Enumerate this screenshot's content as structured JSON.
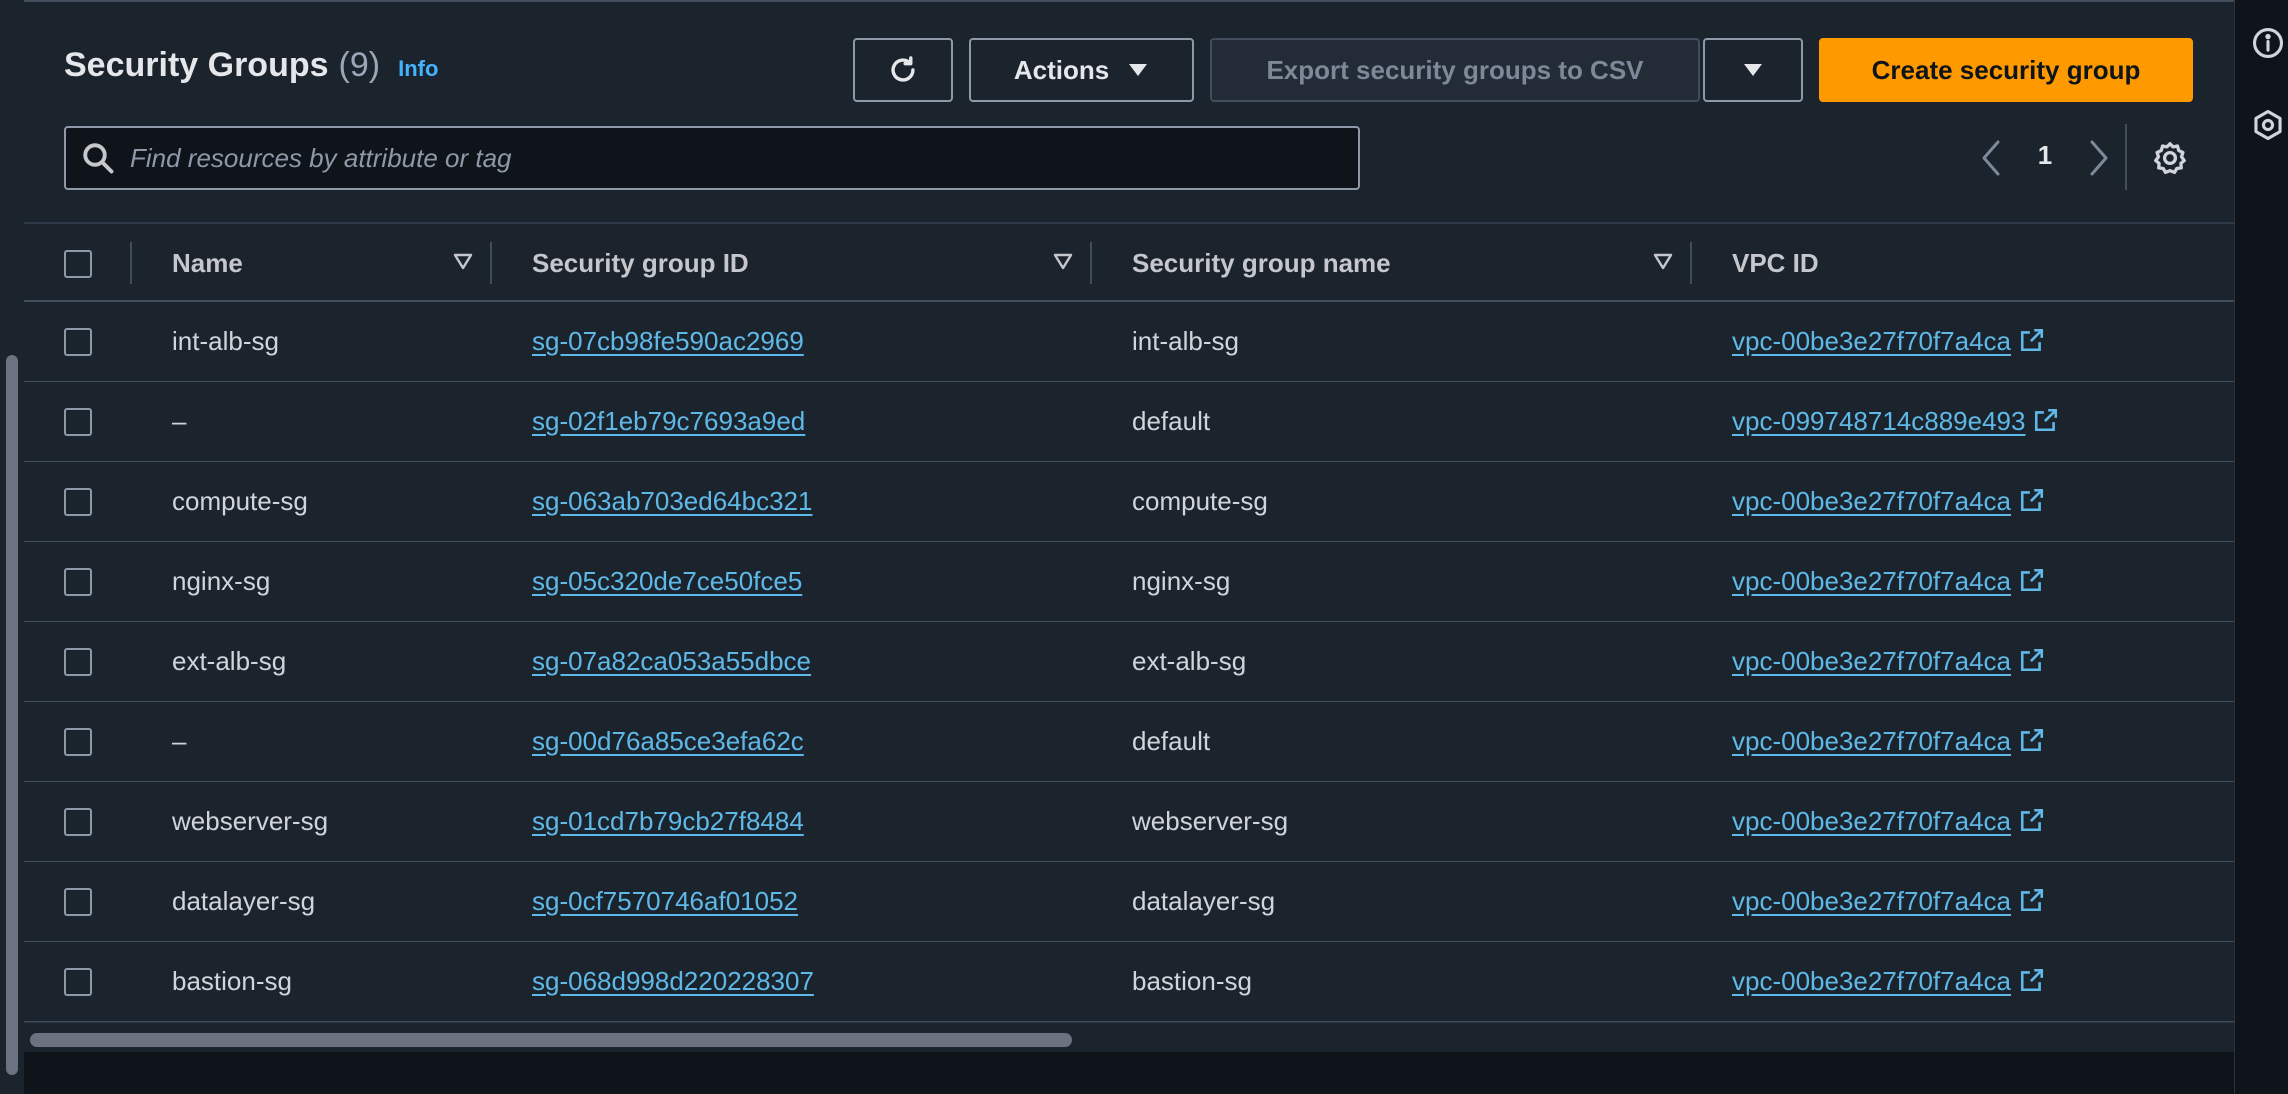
{
  "header": {
    "title": "Security Groups",
    "count": "(9)",
    "info_label": "Info"
  },
  "toolbar": {
    "actions_label": "Actions",
    "export_label": "Export security groups to CSV",
    "create_label": "Create security group"
  },
  "search": {
    "placeholder": "Find resources by attribute or tag"
  },
  "pagination": {
    "current_page": "1"
  },
  "table": {
    "columns": [
      "Name",
      "Security group ID",
      "Security group name",
      "VPC ID"
    ],
    "rows": [
      {
        "name": "int-alb-sg",
        "id": "sg-07cb98fe590ac2969",
        "group_name": "int-alb-sg",
        "vpc": "vpc-00be3e27f70f7a4ca"
      },
      {
        "name": "–",
        "id": "sg-02f1eb79c7693a9ed",
        "group_name": "default",
        "vpc": "vpc-099748714c889e493"
      },
      {
        "name": "compute-sg",
        "id": "sg-063ab703ed64bc321",
        "group_name": "compute-sg",
        "vpc": "vpc-00be3e27f70f7a4ca"
      },
      {
        "name": "nginx-sg",
        "id": "sg-05c320de7ce50fce5",
        "group_name": "nginx-sg",
        "vpc": "vpc-00be3e27f70f7a4ca"
      },
      {
        "name": "ext-alb-sg",
        "id": "sg-07a82ca053a55dbce",
        "group_name": "ext-alb-sg",
        "vpc": "vpc-00be3e27f70f7a4ca"
      },
      {
        "name": "–",
        "id": "sg-00d76a85ce3efa62c",
        "group_name": "default",
        "vpc": "vpc-00be3e27f70f7a4ca"
      },
      {
        "name": "webserver-sg",
        "id": "sg-01cd7b79cb27f8484",
        "group_name": "webserver-sg",
        "vpc": "vpc-00be3e27f70f7a4ca"
      },
      {
        "name": "datalayer-sg",
        "id": "sg-0cf7570746af01052",
        "group_name": "datalayer-sg",
        "vpc": "vpc-00be3e27f70f7a4ca"
      },
      {
        "name": "bastion-sg",
        "id": "sg-068d998d220228307",
        "group_name": "bastion-sg",
        "vpc": "vpc-00be3e27f70f7a4ca"
      }
    ]
  },
  "colors": {
    "accent": "#ff9900",
    "link": "#5fb9e8",
    "info": "#42b4ff",
    "panel": "#1b232d"
  },
  "icons": {
    "refresh": "refresh-icon",
    "actions_caret": "caret-down-icon",
    "search": "search-icon",
    "settings": "gear-icon",
    "external": "external-link-icon"
  }
}
